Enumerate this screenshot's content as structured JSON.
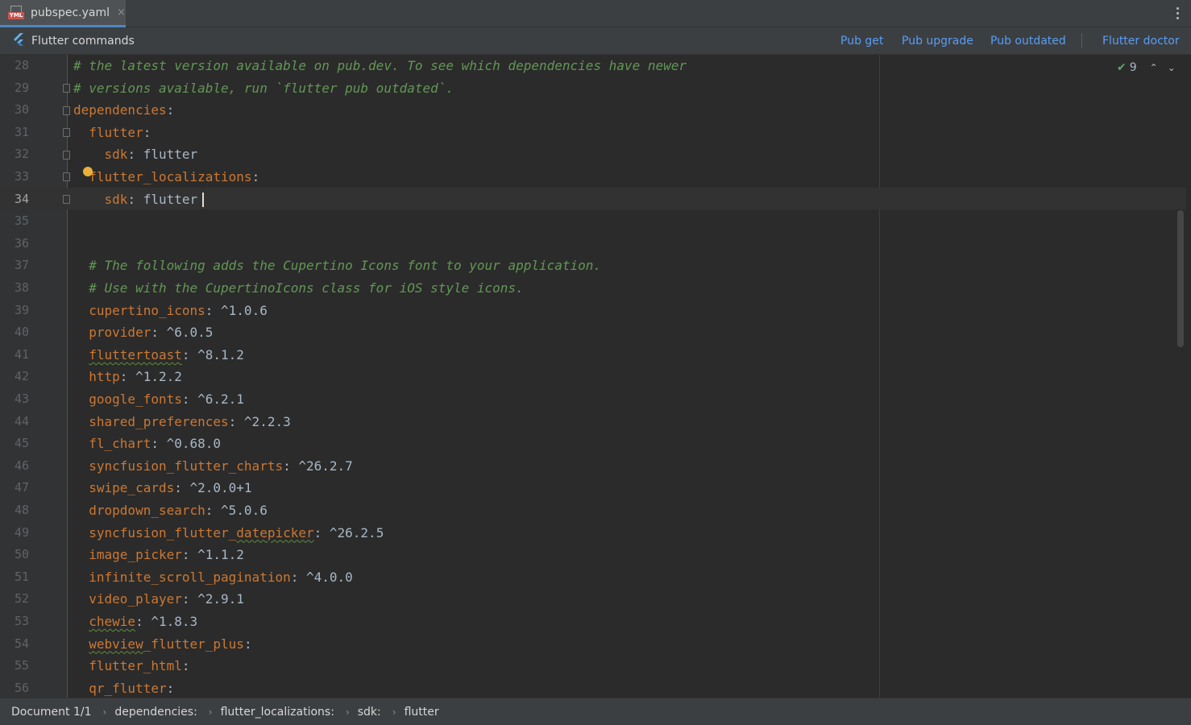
{
  "tab": {
    "title": "pubspec.yaml",
    "close": "×",
    "icon_label": "YML"
  },
  "commands": {
    "title": "Flutter commands",
    "pub_get": "Pub get",
    "pub_upgrade": "Pub upgrade",
    "pub_outdated": "Pub outdated",
    "flutter_doctor": "Flutter doctor"
  },
  "inspections": {
    "count": "9"
  },
  "editor": {
    "current_line": 34,
    "lines": [
      {
        "n": "28",
        "t": [
          [
            "c",
            "# the latest version available on pub.dev. To see which dependencies have newer"
          ]
        ]
      },
      {
        "n": "29",
        "t": [
          [
            "c",
            "# versions available, run `flutter pub outdated`."
          ]
        ]
      },
      {
        "n": "30",
        "t": [
          [
            "k",
            "dependencies"
          ],
          [
            "v",
            ":"
          ]
        ]
      },
      {
        "n": "31",
        "t": [
          [
            "v",
            "  "
          ],
          [
            "k",
            "flutter"
          ],
          [
            "v",
            ":"
          ]
        ]
      },
      {
        "n": "32",
        "t": [
          [
            "v",
            "    "
          ],
          [
            "k",
            "sdk"
          ],
          [
            "v",
            ": flutter"
          ]
        ]
      },
      {
        "n": "33",
        "t": [
          [
            "v",
            "  "
          ],
          [
            "k",
            "flutter_localizations"
          ],
          [
            "v",
            ":"
          ]
        ]
      },
      {
        "n": "34",
        "t": [
          [
            "v",
            "    "
          ],
          [
            "k",
            "sdk"
          ],
          [
            "v",
            ": flutter"
          ]
        ]
      },
      {
        "n": "35",
        "t": []
      },
      {
        "n": "36",
        "t": []
      },
      {
        "n": "37",
        "t": [
          [
            "v",
            "  "
          ],
          [
            "c",
            "# The following adds the Cupertino Icons font to your application."
          ]
        ]
      },
      {
        "n": "38",
        "t": [
          [
            "v",
            "  "
          ],
          [
            "c",
            "# Use with the CupertinoIcons class for iOS style icons."
          ]
        ]
      },
      {
        "n": "39",
        "t": [
          [
            "v",
            "  "
          ],
          [
            "k",
            "cupertino_icons"
          ],
          [
            "v",
            ": ^1.0.6"
          ]
        ]
      },
      {
        "n": "40",
        "t": [
          [
            "v",
            "  "
          ],
          [
            "k",
            "provider"
          ],
          [
            "v",
            ": ^6.0.5"
          ]
        ]
      },
      {
        "n": "41",
        "t": [
          [
            "v",
            "  "
          ],
          [
            "ks",
            "fluttertoast"
          ],
          [
            "v",
            ": ^8.1.2"
          ]
        ]
      },
      {
        "n": "42",
        "t": [
          [
            "v",
            "  "
          ],
          [
            "k",
            "http"
          ],
          [
            "v",
            ": ^1.2.2"
          ]
        ]
      },
      {
        "n": "43",
        "t": [
          [
            "v",
            "  "
          ],
          [
            "k",
            "google_fonts"
          ],
          [
            "v",
            ": ^6.2.1"
          ]
        ]
      },
      {
        "n": "44",
        "t": [
          [
            "v",
            "  "
          ],
          [
            "k",
            "shared_preferences"
          ],
          [
            "v",
            ": ^2.2.3"
          ]
        ]
      },
      {
        "n": "45",
        "t": [
          [
            "v",
            "  "
          ],
          [
            "k",
            "fl_chart"
          ],
          [
            "v",
            ": ^0.68.0"
          ]
        ]
      },
      {
        "n": "46",
        "t": [
          [
            "v",
            "  "
          ],
          [
            "k",
            "syncfusion_flutter_charts"
          ],
          [
            "v",
            ": ^26.2.7"
          ]
        ]
      },
      {
        "n": "47",
        "t": [
          [
            "v",
            "  "
          ],
          [
            "k",
            "swipe_cards"
          ],
          [
            "v",
            ": ^2.0.0+1"
          ]
        ]
      },
      {
        "n": "48",
        "t": [
          [
            "v",
            "  "
          ],
          [
            "k",
            "dropdown_search"
          ],
          [
            "v",
            ": ^5.0.6"
          ]
        ]
      },
      {
        "n": "49",
        "t": [
          [
            "v",
            "  "
          ],
          [
            "k",
            "syncfusion_flutter_"
          ],
          [
            "ks",
            "datepicker"
          ],
          [
            "v",
            ": ^26.2.5"
          ]
        ]
      },
      {
        "n": "50",
        "t": [
          [
            "v",
            "  "
          ],
          [
            "k",
            "image_picker"
          ],
          [
            "v",
            ": ^1.1.2"
          ]
        ]
      },
      {
        "n": "51",
        "t": [
          [
            "v",
            "  "
          ],
          [
            "k",
            "infinite_scroll_pagination"
          ],
          [
            "v",
            ": ^4.0.0"
          ]
        ]
      },
      {
        "n": "52",
        "t": [
          [
            "v",
            "  "
          ],
          [
            "k",
            "video_player"
          ],
          [
            "v",
            ": ^2.9.1"
          ]
        ]
      },
      {
        "n": "53",
        "t": [
          [
            "v",
            "  "
          ],
          [
            "ks",
            "chewie"
          ],
          [
            "v",
            ": ^1.8.3"
          ]
        ]
      },
      {
        "n": "54",
        "t": [
          [
            "v",
            "  "
          ],
          [
            "ks",
            "webview"
          ],
          [
            "k",
            "_flutter_plus"
          ],
          [
            "v",
            ":"
          ]
        ]
      },
      {
        "n": "55",
        "t": [
          [
            "v",
            "  "
          ],
          [
            "k",
            "flutter_html"
          ],
          [
            "v",
            ":"
          ]
        ]
      },
      {
        "n": "56",
        "t": [
          [
            "v",
            "  "
          ],
          [
            "k",
            "qr_flutter"
          ],
          [
            "v",
            ":"
          ]
        ]
      }
    ]
  },
  "status": {
    "document": "Document 1/1",
    "crumbs": [
      "dependencies:",
      "flutter_localizations:",
      "sdk:",
      "flutter"
    ]
  }
}
